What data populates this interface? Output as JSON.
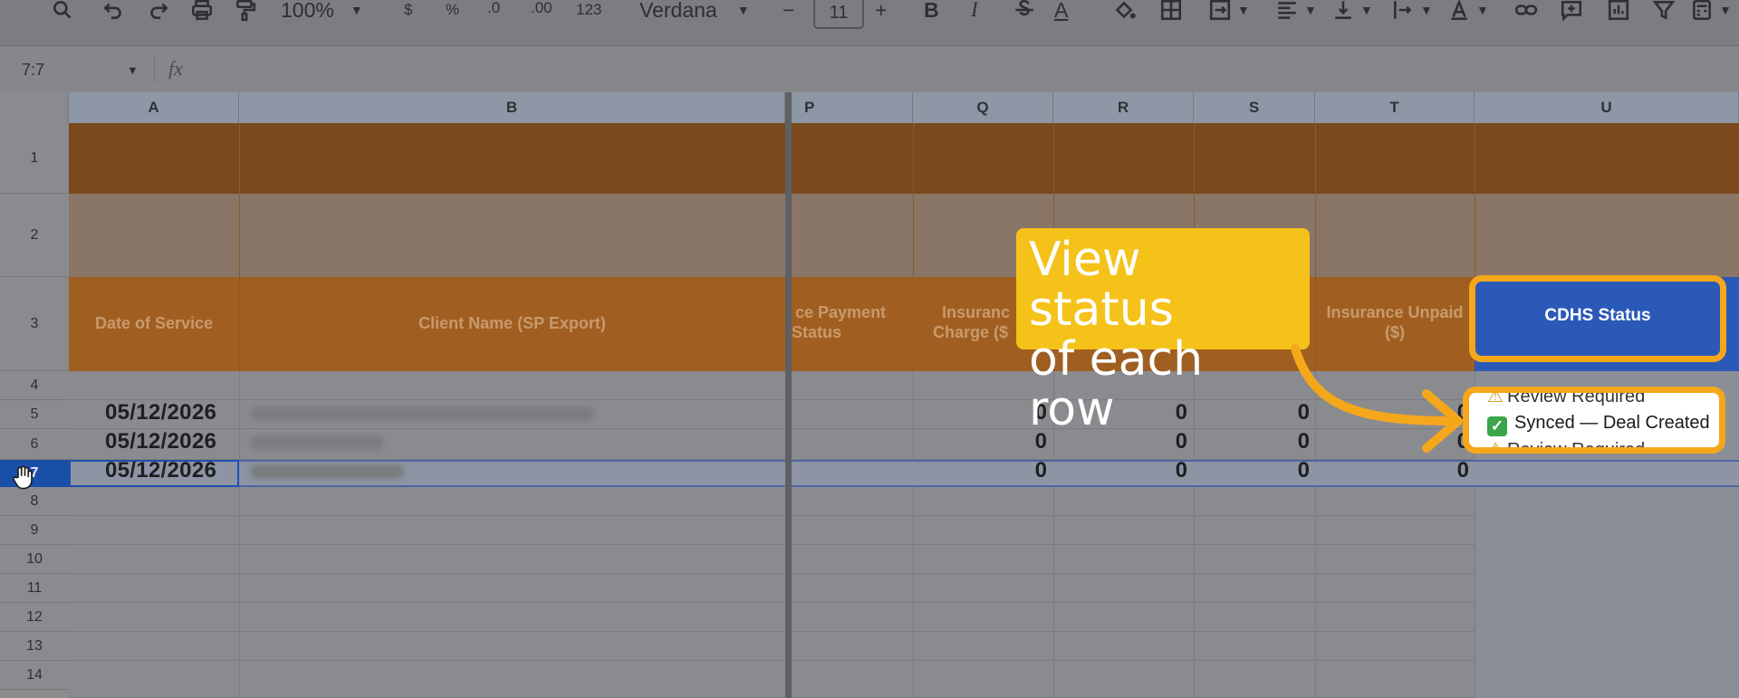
{
  "toolbar": {
    "zoom": "100%",
    "currency": "$",
    "percent": "%",
    "dec_decrease": ".0",
    "dec_increase": ".00",
    "number_format": "123",
    "font": "Verdana",
    "font_size": "11",
    "minus": "−",
    "plus": "+",
    "bold": "B",
    "italic": "I",
    "text_color": "A"
  },
  "formula_bar": {
    "name_box": "7:7",
    "fx": "fx"
  },
  "columns": {
    "A": "A",
    "B": "B",
    "P": "P",
    "Q": "Q",
    "R": "R",
    "S": "S",
    "T": "T",
    "U": "U"
  },
  "rows": [
    "1",
    "2",
    "3",
    "4",
    "5",
    "6",
    "7",
    "8",
    "9",
    "10",
    "11",
    "12",
    "13",
    "14"
  ],
  "headers": {
    "a": "Date of Service",
    "b": "Client Name (SP Export)",
    "p_line1": "ce Payment",
    "p_line2": "Status",
    "q_line1": "Insuranc",
    "q_line2": "Charge ($",
    "t_line1": "Insurance Unpaid",
    "t_line2": "($)",
    "u": "CDHS Status"
  },
  "data_rows": [
    {
      "date": "05/12/2026",
      "q": "0",
      "r": "0",
      "s": "0",
      "t": "0"
    },
    {
      "date": "05/12/2026",
      "q": "0",
      "r": "0",
      "s": "0",
      "t": "0"
    },
    {
      "date": "05/12/2026",
      "q": "0",
      "r": "0",
      "s": "0",
      "t": "0"
    }
  ],
  "status": {
    "top": "Review Required",
    "synced": "Synced — Deal Created",
    "bottom": "Review Required"
  },
  "callout": {
    "line1": "View status",
    "line2": "of each row"
  },
  "colors": {
    "orange_band": "#7a4a1c",
    "header_orange": "#a05f21",
    "cdhs_blue": "#2b59b8",
    "highlight": "#f5a71c",
    "callout_yellow": "#f5c21a"
  }
}
